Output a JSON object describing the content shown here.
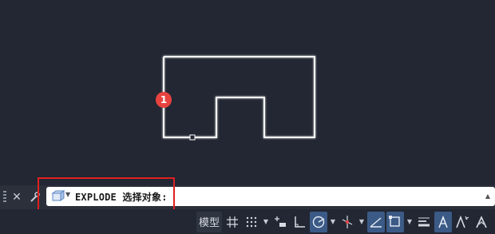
{
  "drawing": {
    "shape": "notched-polyline",
    "stroke": "#ffffff",
    "marker_label": "1",
    "marker_color": "#e8423f"
  },
  "command_line": {
    "text": "EXPLODE 选择对象:",
    "highlight_color": "#e02020"
  },
  "status_bar": {
    "model_label": "模型",
    "items": [
      "grid-icon",
      "snap-dots-icon",
      "dropdown-caret",
      "infer-constraints-icon",
      "ortho-icon",
      "polar-tracking-icon",
      "dropdown-caret",
      "isodraft-icon",
      "dropdown-caret",
      "object-snap-tracking-icon",
      "object-snap-icon",
      "dropdown-caret",
      "lineweight-icon",
      "annotation-visibility-icon",
      "auto-scale-icon",
      "annotation-scale-icon"
    ],
    "accent": "#3b5a86"
  }
}
